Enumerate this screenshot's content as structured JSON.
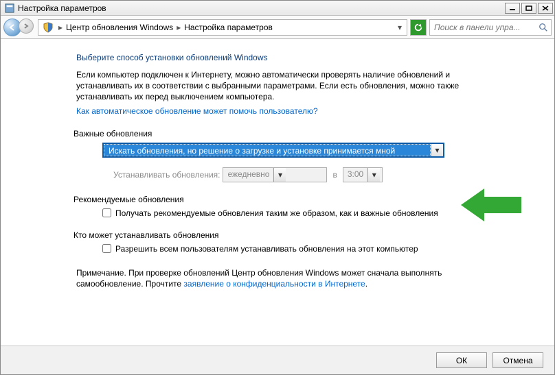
{
  "window": {
    "title": "Настройка параметров"
  },
  "breadcrumb": {
    "item1": "Центр обновления Windows",
    "item2": "Настройка параметров"
  },
  "search": {
    "placeholder": "Поиск в панели упра..."
  },
  "main": {
    "heading": "Выберите способ установки обновлений Windows",
    "para": "Если компьютер подключен к Интернету, можно автоматически проверять наличие обновлений и устанавливать их в соответствии с выбранными параметрами. Если есть обновления, можно также устанавливать их перед выключением компьютера.",
    "help_link": "Как автоматическое обновление может помочь пользователю?"
  },
  "important": {
    "title": "Важные обновления",
    "selected": "Искать обновления, но решение о загрузке и установке принимается мной",
    "schedule_label": "Устанавливать обновления:",
    "freq": "ежедневно",
    "at": "в",
    "time": "3:00"
  },
  "recommended": {
    "title": "Рекомендуемые обновления",
    "checkbox": "Получать рекомендуемые обновления таким же образом, как и важные обновления"
  },
  "who": {
    "title": "Кто может устанавливать обновления",
    "checkbox": "Разрешить всем пользователям устанавливать обновления на этот компьютер"
  },
  "note": {
    "prefix": "Примечание. При проверке обновлений Центр обновления Windows может сначала выполнять самообновление. Прочтите ",
    "link": "заявление о конфиденциальности в Интернете",
    "suffix": "."
  },
  "footer": {
    "ok": "ОК",
    "cancel": "Отмена"
  }
}
